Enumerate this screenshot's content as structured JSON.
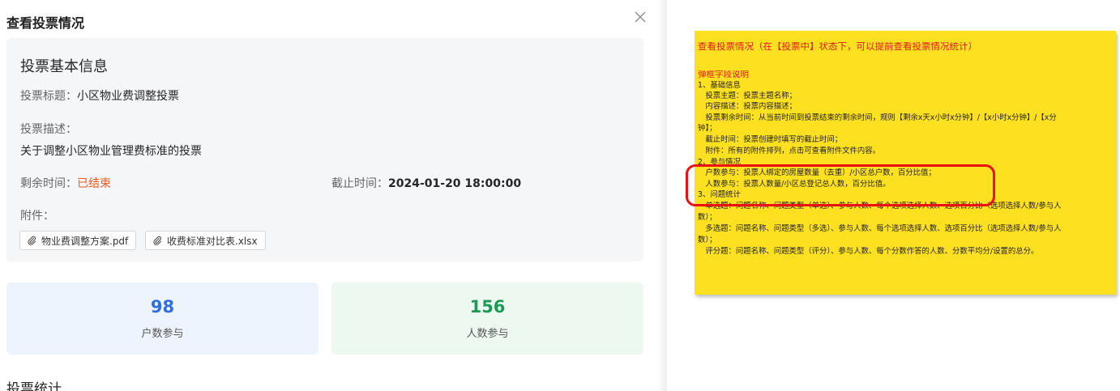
{
  "drawer": {
    "title": "查看投票情况",
    "info": {
      "heading": "投票基本信息",
      "title_label": "投票标题：",
      "title_value": "小区物业费调整投票",
      "desc_label": "投票描述：",
      "desc_value": "关于调整小区物业管理费标准的投票",
      "remaining_label": "剩余时间：",
      "remaining_value": "已结束",
      "deadline_label": "截止时间：",
      "deadline_value": "2024-01-20 18:00:00",
      "attach_label": "附件：",
      "attachments": [
        "物业费调整方案.pdf",
        "收费标准对比表.xlsx"
      ]
    },
    "stats": [
      {
        "value": "98",
        "label": "户数参与"
      },
      {
        "value": "156",
        "label": "人数参与"
      }
    ],
    "section_title": "投票统计"
  },
  "note": {
    "title": "查看投票情况（在【投票中】状态下，可以提前查看投票情况统计）",
    "subtitle": "弹框字段说明",
    "lines": [
      "1、基础信息",
      "　投票主题：投票主题名称；",
      "　内容描述：投票内容描述；",
      "　投票剩余时间：从当前时间到投票结束的剩余时间，规则【剩余x天x小时x分钟】/【x小时x分钟】/【x分",
      "钟】；",
      "　截止时间：投票创建时填写的截止时间；",
      "　附件：所有的附件排列，点击可查看附件文件内容。",
      "2、参与情况",
      "　户数参与：投票人绑定的房屋数量（去重）/小区总户数，百分比值；",
      "　人数参与：投票人数量/小区总登记总人数，百分比值。",
      "3、问题统计",
      "　单选题：问题名称、问题类型（单选）、参与人数、每个选项选择人数、选项百分比（选项选择人数/参与人",
      "数）；",
      "　多选题：问题名称、问题类型（多选）、参与人数、每个选项选择人数、选项百分比（选项选择人数/参与人",
      "数）；",
      "　评分题：问题名称、问题类型（评分）、参与人数、每个分数作答的人数、分数平均分/设置的总分。"
    ]
  },
  "colors": {
    "ended": "#f05a18",
    "stat_blue": "#2f6fe0",
    "stat_green": "#1f9a56",
    "note_bg": "#fde020",
    "note_red": "#e41b1b"
  }
}
